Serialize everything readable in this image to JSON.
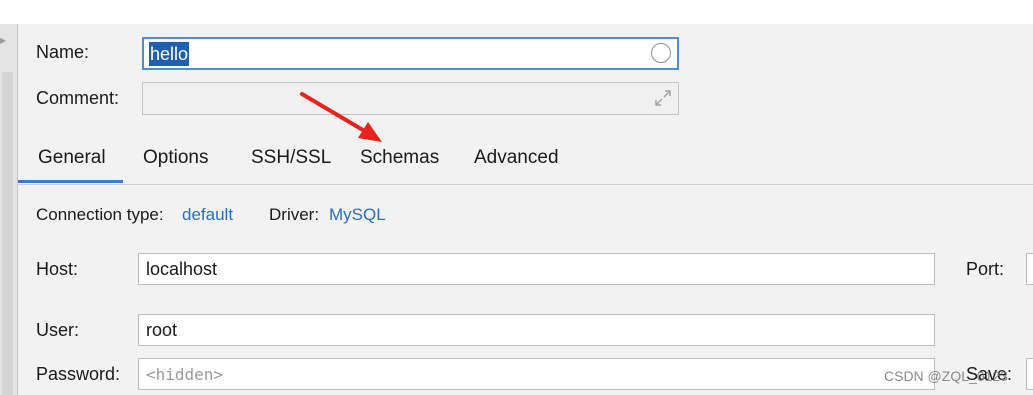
{
  "form": {
    "name_label": "Name:",
    "name_value": "hello",
    "comment_label": "Comment:",
    "comment_value": ""
  },
  "tabs": [
    {
      "label": "General",
      "active": true
    },
    {
      "label": "Options",
      "active": false
    },
    {
      "label": "SSH/SSL",
      "active": false
    },
    {
      "label": "Schemas",
      "active": false
    },
    {
      "label": "Advanced",
      "active": false
    }
  ],
  "general": {
    "connection_type_label": "Connection type:",
    "connection_type_value": "default",
    "driver_label": "Driver:",
    "driver_value": "MySQL",
    "host_label": "Host:",
    "host_value": "localhost",
    "port_label": "Port:",
    "user_label": "User:",
    "user_value": "root",
    "password_label": "Password:",
    "password_placeholder": "<hidden>",
    "save_label": "Save:"
  },
  "watermark": "CSDN @ZQL_0123",
  "colors": {
    "accent": "#3a7bd5",
    "link": "#2a6ebd",
    "selection": "#1e5fb3",
    "annotation_arrow": "#e8231f"
  }
}
